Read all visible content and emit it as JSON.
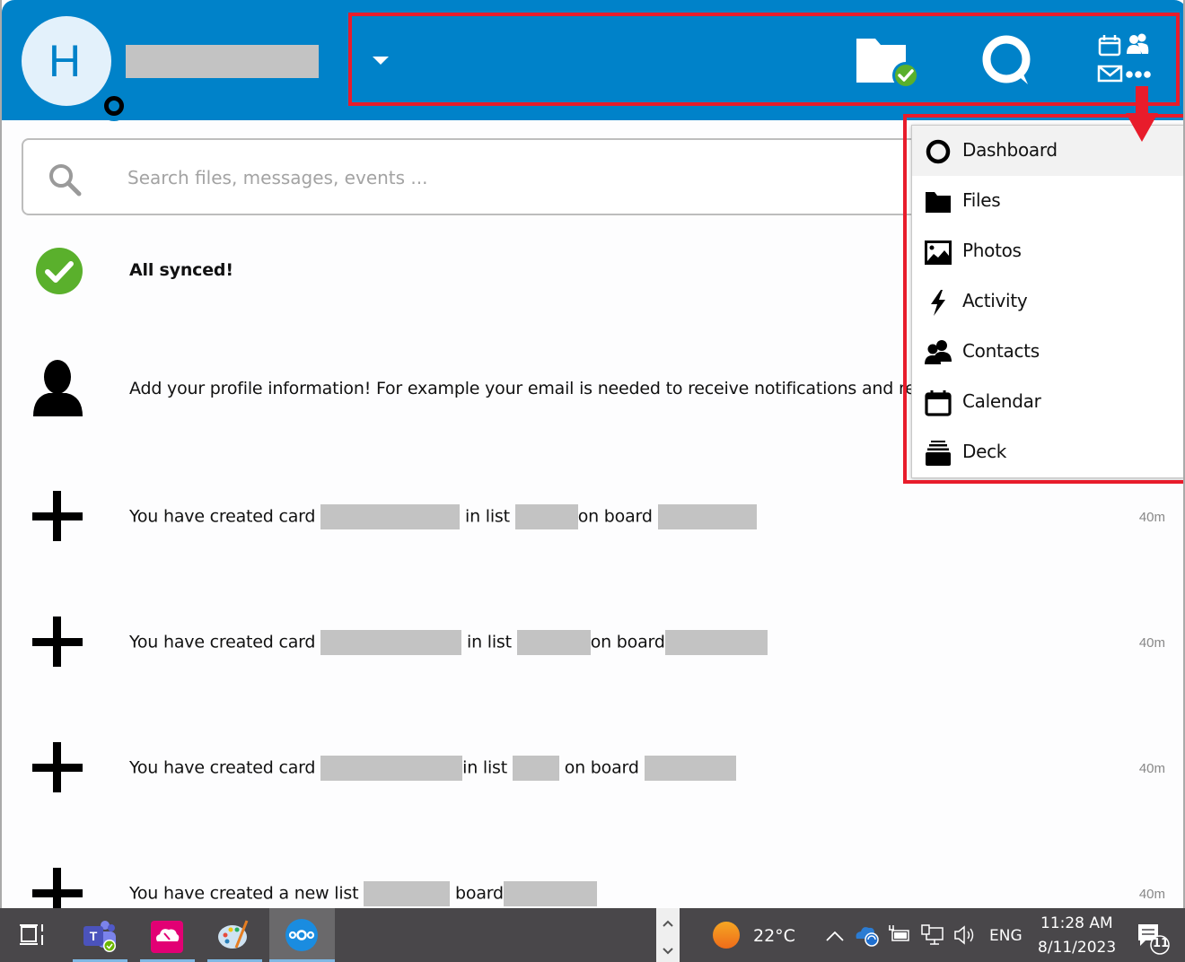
{
  "header": {
    "avatar_letter": "H",
    "account_name_redacted": true,
    "buttons": {
      "files": "files-sync-status",
      "talk": "talk",
      "apps": "apps-menu"
    }
  },
  "search": {
    "placeholder": "Search files, messages, events ...",
    "value": ""
  },
  "activities": [
    {
      "icon": "check-circle-icon",
      "text": "All synced!",
      "bold": true,
      "time": ""
    },
    {
      "icon": "user-icon",
      "text": "Add your profile information! For example your email is needed to receive notifications and reset your password.",
      "bold": false,
      "time": ""
    },
    {
      "icon": "plus-icon",
      "parts": [
        "You have created card",
        "in list",
        "on board"
      ],
      "time": "40m"
    },
    {
      "icon": "plus-icon",
      "parts": [
        "You have created card",
        "in list",
        "on board"
      ],
      "time": "40m"
    },
    {
      "icon": "plus-icon",
      "parts": [
        "You have created card",
        "in list",
        "on board"
      ],
      "time": "40m"
    },
    {
      "icon": "plus-icon",
      "parts": [
        "You have created a new list",
        "board"
      ],
      "time": "40m"
    }
  ],
  "app_menu": {
    "items": [
      {
        "label": "Dashboard",
        "icon": "dashboard-icon",
        "active": true
      },
      {
        "label": "Files",
        "icon": "folder-icon",
        "active": false
      },
      {
        "label": "Photos",
        "icon": "image-icon",
        "active": false
      },
      {
        "label": "Activity",
        "icon": "lightning-icon",
        "active": false
      },
      {
        "label": "Contacts",
        "icon": "contacts-icon",
        "active": false
      },
      {
        "label": "Calendar",
        "icon": "calendar-icon",
        "active": false
      },
      {
        "label": "Deck",
        "icon": "deck-icon",
        "active": false
      }
    ]
  },
  "taskbar": {
    "apps": [
      "task-view",
      "microsoft-teams",
      "cloud-app",
      "paint",
      "nextcloud"
    ],
    "weather": {
      "temp": "22°C"
    },
    "language": "ENG",
    "time": "11:28 AM",
    "date": "8/11/2023",
    "notifications_count": "11"
  },
  "colors": {
    "brand": "#0082c9",
    "highlight": "#e81c2b",
    "success": "#5ab02c"
  }
}
